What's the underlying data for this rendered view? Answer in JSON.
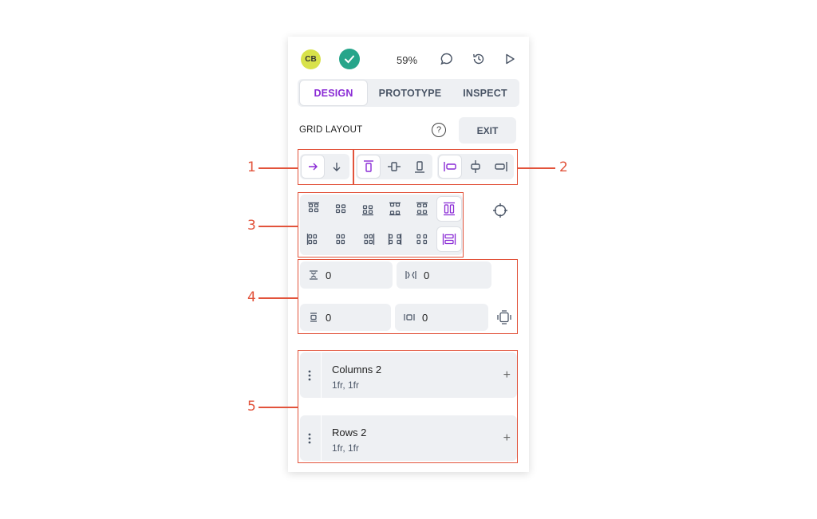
{
  "header": {
    "avatar_initials": "CB",
    "zoom": "59%",
    "icons": [
      "check-icon",
      "comment-icon",
      "history-icon",
      "play-icon"
    ]
  },
  "tabs": [
    {
      "label": "DESIGN",
      "active": true
    },
    {
      "label": "PROTOTYPE",
      "active": false
    },
    {
      "label": "INSPECT",
      "active": false
    }
  ],
  "grid_layout": {
    "title": "GRID LAYOUT",
    "help": "?",
    "exit_label": "EXIT"
  },
  "gaps": {
    "row_gap": "0",
    "column_gap": "0",
    "vertical_padding": "0",
    "horizontal_padding": "0"
  },
  "tracks": [
    {
      "name": "Columns 2",
      "value": "1fr, 1fr",
      "add": "+"
    },
    {
      "name": "Rows 2",
      "value": "1fr, 1fr",
      "add": "+"
    }
  ],
  "callouts": [
    "1",
    "2",
    "3",
    "4",
    "5"
  ],
  "colors": {
    "accent": "#8a2bd5",
    "callout": "#e2533b",
    "status": "#26a58a",
    "avatar": "#d8e24a"
  }
}
